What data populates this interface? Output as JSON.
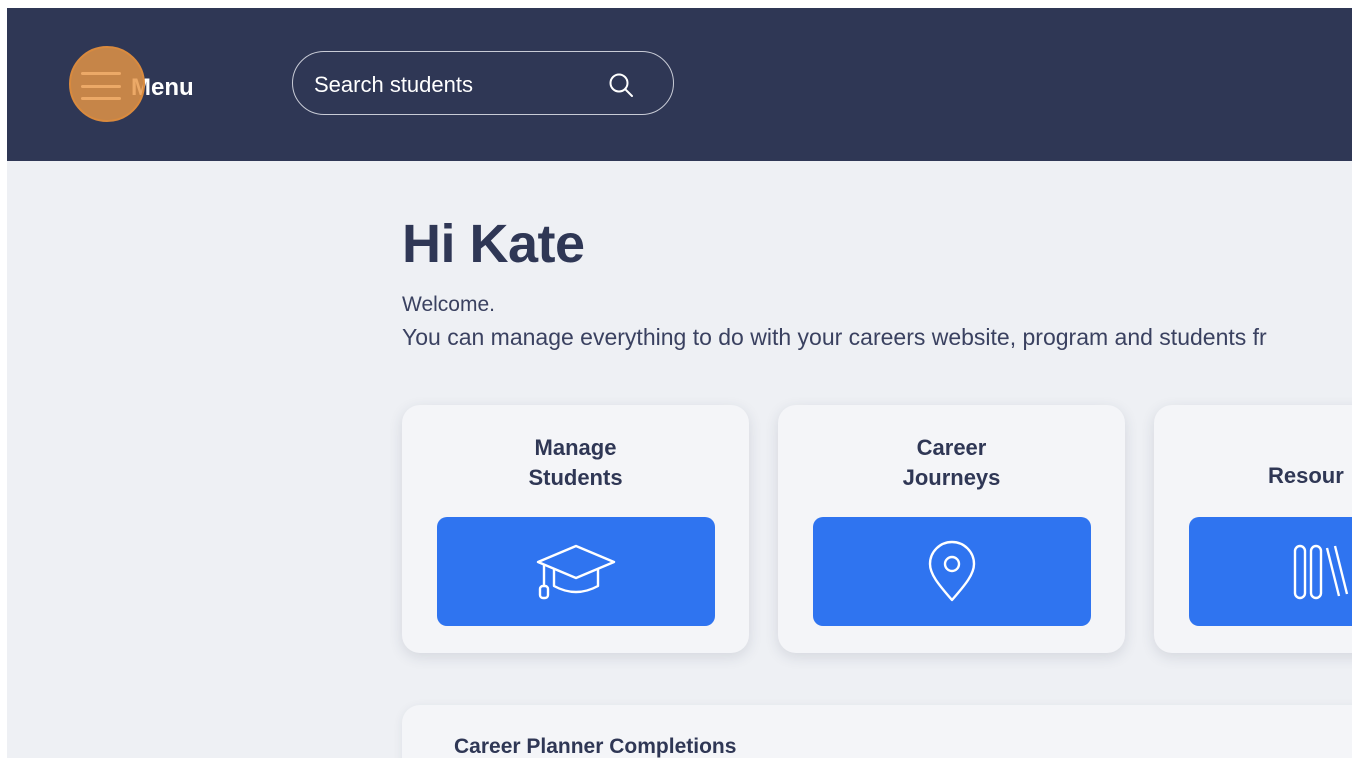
{
  "header": {
    "menu_label": "Menu",
    "search_label": "Search students"
  },
  "main": {
    "greeting": "Hi Kate",
    "welcome_line1": "Welcome.",
    "welcome_line2": "You can manage everything to do with your careers website, program and students fr"
  },
  "cards": [
    {
      "title_line1": "Manage",
      "title_line2": "Students",
      "icon": "graduation-cap-icon"
    },
    {
      "title_line1": "Career",
      "title_line2": "Journeys",
      "icon": "map-pin-icon"
    },
    {
      "title": "Resour",
      "icon": "books-icon"
    }
  ],
  "planner": {
    "title": "Career Planner Completions"
  },
  "colors": {
    "header_bg": "#2f3755",
    "page_bg": "#eef0f4",
    "accent_blue": "#2f74f0",
    "click_marker": "#e89646"
  }
}
